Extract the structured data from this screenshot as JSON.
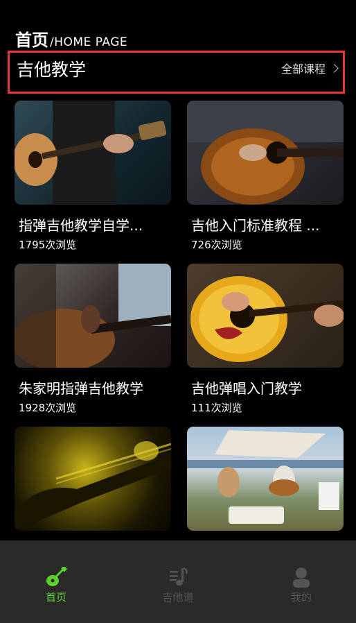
{
  "header": {
    "title": "首页",
    "subtitle": "/HOME PAGE"
  },
  "section": {
    "title": "吉他教学",
    "more_label": "全部课程"
  },
  "courses": [
    {
      "title": "指弹吉他教学自学...",
      "views": "1795次浏览"
    },
    {
      "title": "吉他入门标准教程 ...",
      "views": "726次浏览"
    },
    {
      "title": "朱家明指弹吉他教学",
      "views": "1928次浏览"
    },
    {
      "title": "吉他弹唱入门教学",
      "views": "111次浏览"
    },
    {
      "title": "",
      "views": ""
    },
    {
      "title": "",
      "views": ""
    }
  ],
  "tabbar": [
    {
      "label": "首页",
      "icon": "guitar-icon",
      "active": true
    },
    {
      "label": "吉他谱",
      "icon": "music-sheet-icon",
      "active": false
    },
    {
      "label": "我的",
      "icon": "user-icon",
      "active": false
    }
  ],
  "colors": {
    "accent": "#5ad22e",
    "highlight_border": "#e53935",
    "tabbar_bg": "#2a2a2a"
  }
}
